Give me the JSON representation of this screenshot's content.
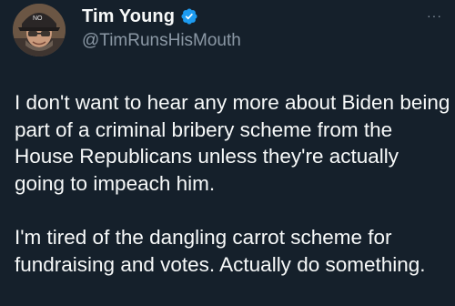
{
  "author": {
    "display_name": "Tim Young",
    "handle": "@TimRunsHisMouth",
    "avatar_icon": "profile-photo",
    "verified_icon": "verified-badge-icon"
  },
  "more_menu_label": "···",
  "tweet": {
    "paragraphs": [
      "I don't want to hear any more about Biden being part of a criminal bribery scheme from the House Republicans unless they're actually going to impeach him.",
      "I'm tired of the dangling carrot scheme for fundraising and votes. Actually do something."
    ]
  },
  "colors": {
    "background": "#15202b",
    "text": "#f7f9f9",
    "secondary_text": "#8b98a5",
    "verified": "#1d9bf0"
  }
}
